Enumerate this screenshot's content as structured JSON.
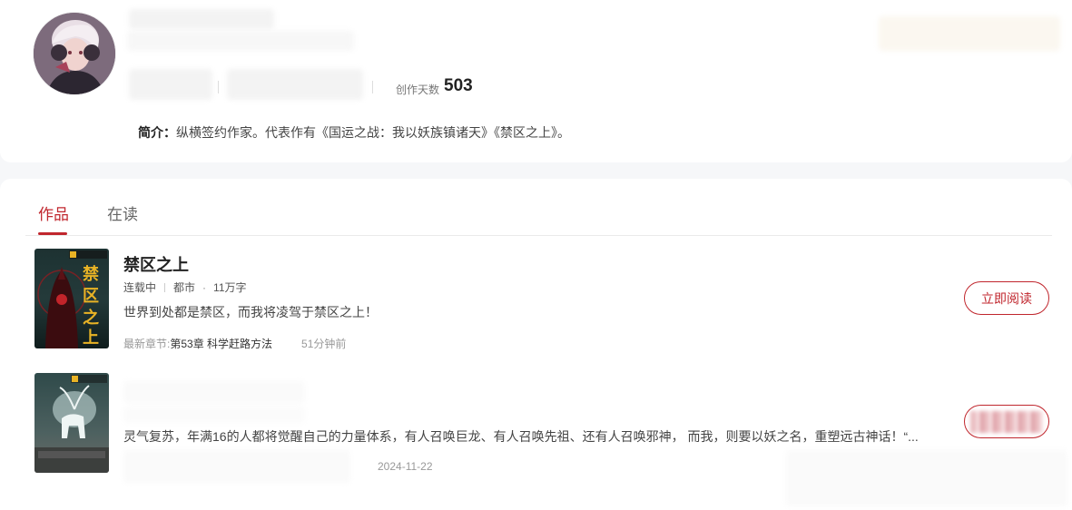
{
  "profile": {
    "avatar_alt": "author avatar",
    "stats": {
      "days_label": "创作天数",
      "days_value": "503"
    },
    "intro": {
      "label": "简介：",
      "text": "纵横签约作家。代表作有《国运之战：我以妖族镇诸天》《禁区之上》。"
    }
  },
  "tabs": [
    {
      "label": "作品",
      "active": true
    },
    {
      "label": "在读",
      "active": false
    }
  ],
  "books": [
    {
      "title": "禁区之上",
      "status": "连载中",
      "category": "都市",
      "word_count": "11万字",
      "description": "世界到处都是禁区，而我将凌驾于禁区之上！",
      "latest_label": "最新章节:",
      "latest_chapter": "第53章 科学赶路方法",
      "latest_time": "51分钟前",
      "read_button": "立即阅读"
    },
    {
      "description": "灵气复苏，年满16的人都将觉醒自己的力量体系，有人召唤巨龙、有人召唤先祖、还有人召唤邪神， 而我，则要以妖之名，重塑远古神话！“...",
      "date": "2024-11-22"
    }
  ],
  "colors": {
    "accent": "#c0262d",
    "page_bg": "#f6f7f9",
    "card_bg": "#ffffff"
  }
}
